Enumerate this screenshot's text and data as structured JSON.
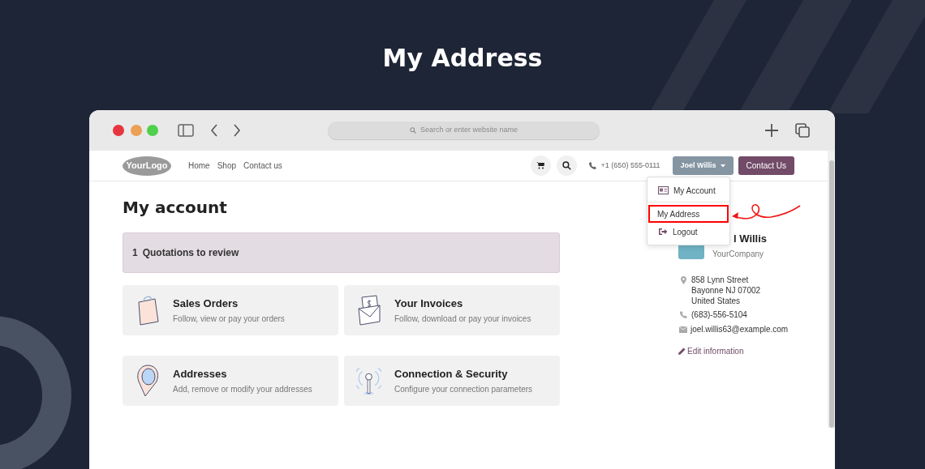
{
  "title": "My Address",
  "browser": {
    "address_placeholder": "Search or enter website name"
  },
  "navbar": {
    "logo": "YourLogo",
    "links": [
      "Home",
      "Shop",
      "Contact us"
    ],
    "phone": "+1 (650) 555-0111",
    "user_button": "Joel Willis",
    "cta": "Contact Us"
  },
  "user_menu": {
    "items": [
      {
        "kind": "icon",
        "label": "My Account",
        "highlighted": false
      },
      {
        "kind": "divider"
      },
      {
        "kind": "plain",
        "label": "My Address",
        "highlighted": true
      },
      {
        "kind": "icon",
        "label": "Logout",
        "highlighted": false
      }
    ]
  },
  "page": {
    "heading": "My account",
    "alert": {
      "count": "1",
      "text": "Quotations to review"
    },
    "cards": [
      {
        "kind": "bag",
        "title": "Sales Orders",
        "subtitle": "Follow, view or pay your orders"
      },
      {
        "kind": "invoice",
        "title": "Your Invoices",
        "subtitle": "Follow, download or pay your invoices"
      },
      {
        "kind": "pin",
        "title": "Addresses",
        "subtitle": "Add, remove or modify your addresses"
      },
      {
        "kind": "antenna",
        "title": "Connection & Security",
        "subtitle": "Configure your connection parameters"
      }
    ]
  },
  "profile": {
    "name": "l Willis",
    "company": "YourCompany",
    "address": [
      "858 Lynn Street",
      "Bayonne NJ 07002",
      "United States"
    ],
    "phone": "(683)-556-5104",
    "email": "joel.willis63@example.com",
    "edit_link": "Edit information"
  }
}
